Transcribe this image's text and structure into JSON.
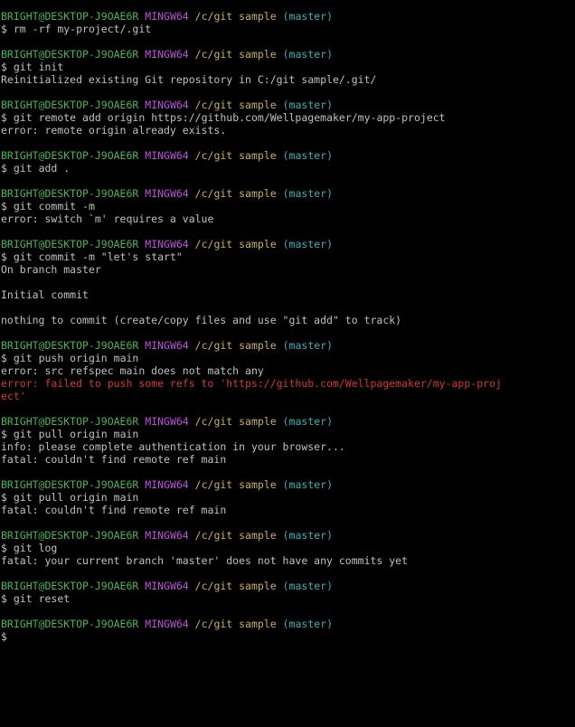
{
  "prompt": {
    "user_host": "BRIGHT@DESKTOP-J9OAE6R",
    "system": "MINGW64",
    "path": "/c/git sample",
    "branch": "(master)",
    "symbol": "$"
  },
  "colors": {
    "background": "#000000",
    "text": "#c0c0c0",
    "user_host": "#3fb950",
    "system": "#c04ee0",
    "path": "#c9b343",
    "branch": "#2eb5b5",
    "error": "#d83434"
  },
  "blocks": [
    {
      "command": "rm -rf my-project/.git",
      "output": []
    },
    {
      "command": "git init",
      "output": [
        {
          "text": "Reinitialized existing Git repository in C:/git sample/.git/",
          "type": "out"
        }
      ]
    },
    {
      "command": "git remote add origin https://github.com/Wellpagemaker/my-app-project",
      "output": [
        {
          "text": "error: remote origin already exists.",
          "type": "out"
        }
      ]
    },
    {
      "command": "git add .",
      "output": []
    },
    {
      "command": "git commit -m",
      "output": [
        {
          "text": "error: switch `m' requires a value",
          "type": "out"
        }
      ]
    },
    {
      "command": "git commit -m \"let's start\"",
      "output": [
        {
          "text": "On branch master",
          "type": "out"
        },
        {
          "text": "",
          "type": "out"
        },
        {
          "text": "Initial commit",
          "type": "out"
        },
        {
          "text": "",
          "type": "out"
        },
        {
          "text": "nothing to commit (create/copy files and use \"git add\" to track)",
          "type": "out"
        }
      ]
    },
    {
      "command": "git push origin main",
      "output": [
        {
          "text": "error: src refspec main does not match any",
          "type": "out"
        },
        {
          "text": "error: failed to push some refs to 'https://github.com/Wellpagemaker/my-app-proj",
          "type": "err"
        },
        {
          "text": "ect'",
          "type": "err"
        }
      ]
    },
    {
      "command": "git pull origin main",
      "output": [
        {
          "text": "info: please complete authentication in your browser...",
          "type": "out"
        },
        {
          "text": "fatal: couldn't find remote ref main",
          "type": "out"
        }
      ]
    },
    {
      "command": "git pull origin main",
      "output": [
        {
          "text": "fatal: couldn't find remote ref main",
          "type": "out"
        }
      ]
    },
    {
      "command": "git log",
      "output": [
        {
          "text": "fatal: your current branch 'master' does not have any commits yet",
          "type": "out"
        }
      ]
    },
    {
      "command": "git reset",
      "output": []
    },
    {
      "command": "",
      "output": [],
      "active": true
    }
  ]
}
